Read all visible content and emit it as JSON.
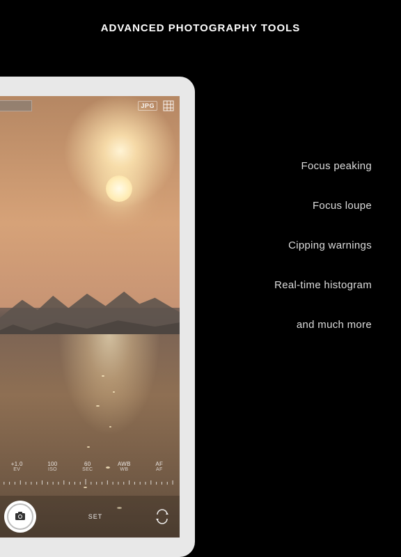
{
  "heading": "ADVANCED PHOTOGRAPHY TOOLS",
  "features": [
    "Focus peaking",
    "Focus loupe",
    "Cipping warnings",
    "Real-time histogram",
    "and much more"
  ],
  "viewfinder": {
    "format_badge": "JPG",
    "params": {
      "ev_label": "EV",
      "ev_value": "+1.0",
      "iso_label": "ISO",
      "iso_value": "100",
      "sec_label": "SEC",
      "sec_value": "60",
      "wb_label": "WB",
      "wb_value": "AWB",
      "af_label": "AF",
      "af_value": "AF"
    },
    "settings_label": "SET"
  }
}
